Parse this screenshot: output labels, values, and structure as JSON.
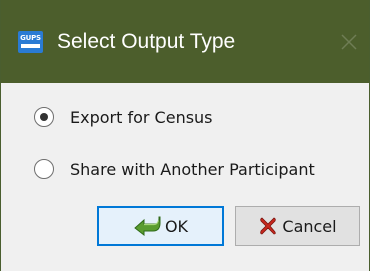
{
  "window": {
    "title": "Select Output Type",
    "logo_text": "GUPS",
    "titlebar_color": "#4c5e2c"
  },
  "options": [
    {
      "label": "Export for Census",
      "selected": true
    },
    {
      "label": "Share with Another Participant",
      "selected": false
    }
  ],
  "buttons": {
    "ok_label": "OK",
    "ok_icon": "green-arrow-icon",
    "cancel_label": "Cancel",
    "cancel_icon": "red-x-icon"
  }
}
